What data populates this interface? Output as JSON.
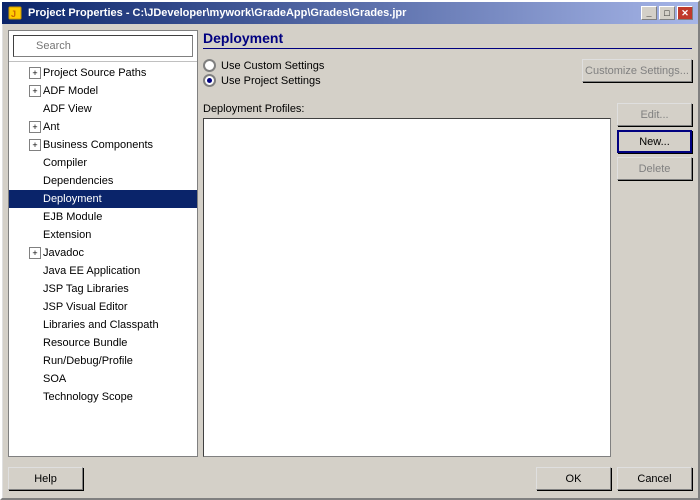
{
  "window": {
    "title": "Project Properties - C:\\JDeveloper\\mywork\\GradeApp\\Grades\\Grades.jpr",
    "icon": "gear-icon"
  },
  "titleButtons": {
    "minimize": "_",
    "maximize": "□",
    "close": "✕"
  },
  "search": {
    "placeholder": "Search",
    "value": ""
  },
  "tree": {
    "items": [
      {
        "id": "project-source-paths",
        "label": "Project Source Paths",
        "indent": 1,
        "hasExpand": true,
        "selected": false
      },
      {
        "id": "adf-model",
        "label": "ADF Model",
        "indent": 1,
        "hasExpand": true,
        "selected": false
      },
      {
        "id": "adf-view",
        "label": "ADF View",
        "indent": 1,
        "hasExpand": false,
        "selected": false
      },
      {
        "id": "ant",
        "label": "Ant",
        "indent": 1,
        "hasExpand": true,
        "selected": false
      },
      {
        "id": "business-components",
        "label": "Business Components",
        "indent": 1,
        "hasExpand": true,
        "selected": false
      },
      {
        "id": "compiler",
        "label": "Compiler",
        "indent": 1,
        "hasExpand": false,
        "selected": false
      },
      {
        "id": "dependencies",
        "label": "Dependencies",
        "indent": 1,
        "hasExpand": false,
        "selected": false
      },
      {
        "id": "deployment",
        "label": "Deployment",
        "indent": 1,
        "hasExpand": false,
        "selected": true
      },
      {
        "id": "ejb-module",
        "label": "EJB Module",
        "indent": 1,
        "hasExpand": false,
        "selected": false
      },
      {
        "id": "extension",
        "label": "Extension",
        "indent": 1,
        "hasExpand": false,
        "selected": false
      },
      {
        "id": "javadoc",
        "label": "Javadoc",
        "indent": 1,
        "hasExpand": true,
        "selected": false
      },
      {
        "id": "java-ee-application",
        "label": "Java EE Application",
        "indent": 1,
        "hasExpand": false,
        "selected": false
      },
      {
        "id": "jsp-tag-libraries",
        "label": "JSP Tag Libraries",
        "indent": 1,
        "hasExpand": false,
        "selected": false
      },
      {
        "id": "jsp-visual-editor",
        "label": "JSP Visual Editor",
        "indent": 1,
        "hasExpand": false,
        "selected": false
      },
      {
        "id": "libraries-classpath",
        "label": "Libraries and Classpath",
        "indent": 1,
        "hasExpand": false,
        "selected": false
      },
      {
        "id": "resource-bundle",
        "label": "Resource Bundle",
        "indent": 1,
        "hasExpand": false,
        "selected": false
      },
      {
        "id": "run-debug-profile",
        "label": "Run/Debug/Profile",
        "indent": 1,
        "hasExpand": false,
        "selected": false
      },
      {
        "id": "soa",
        "label": "SOA",
        "indent": 1,
        "hasExpand": false,
        "selected": false
      },
      {
        "id": "technology-scope",
        "label": "Technology Scope",
        "indent": 1,
        "hasExpand": false,
        "selected": false
      }
    ]
  },
  "rightPanel": {
    "title": "Deployment",
    "customizeSettingsBtn": "Customize Settings...",
    "radioOptions": [
      {
        "id": "custom-settings",
        "label": "Use Custom Settings",
        "checked": false
      },
      {
        "id": "project-settings",
        "label": "Use Project Settings",
        "checked": true
      }
    ],
    "deploymentProfilesLabel": "Deployment Profiles:",
    "buttons": {
      "edit": "Edit...",
      "new": "New...",
      "delete": "Delete"
    }
  },
  "bottomButtons": {
    "help": "Help",
    "ok": "OK",
    "cancel": "Cancel"
  }
}
